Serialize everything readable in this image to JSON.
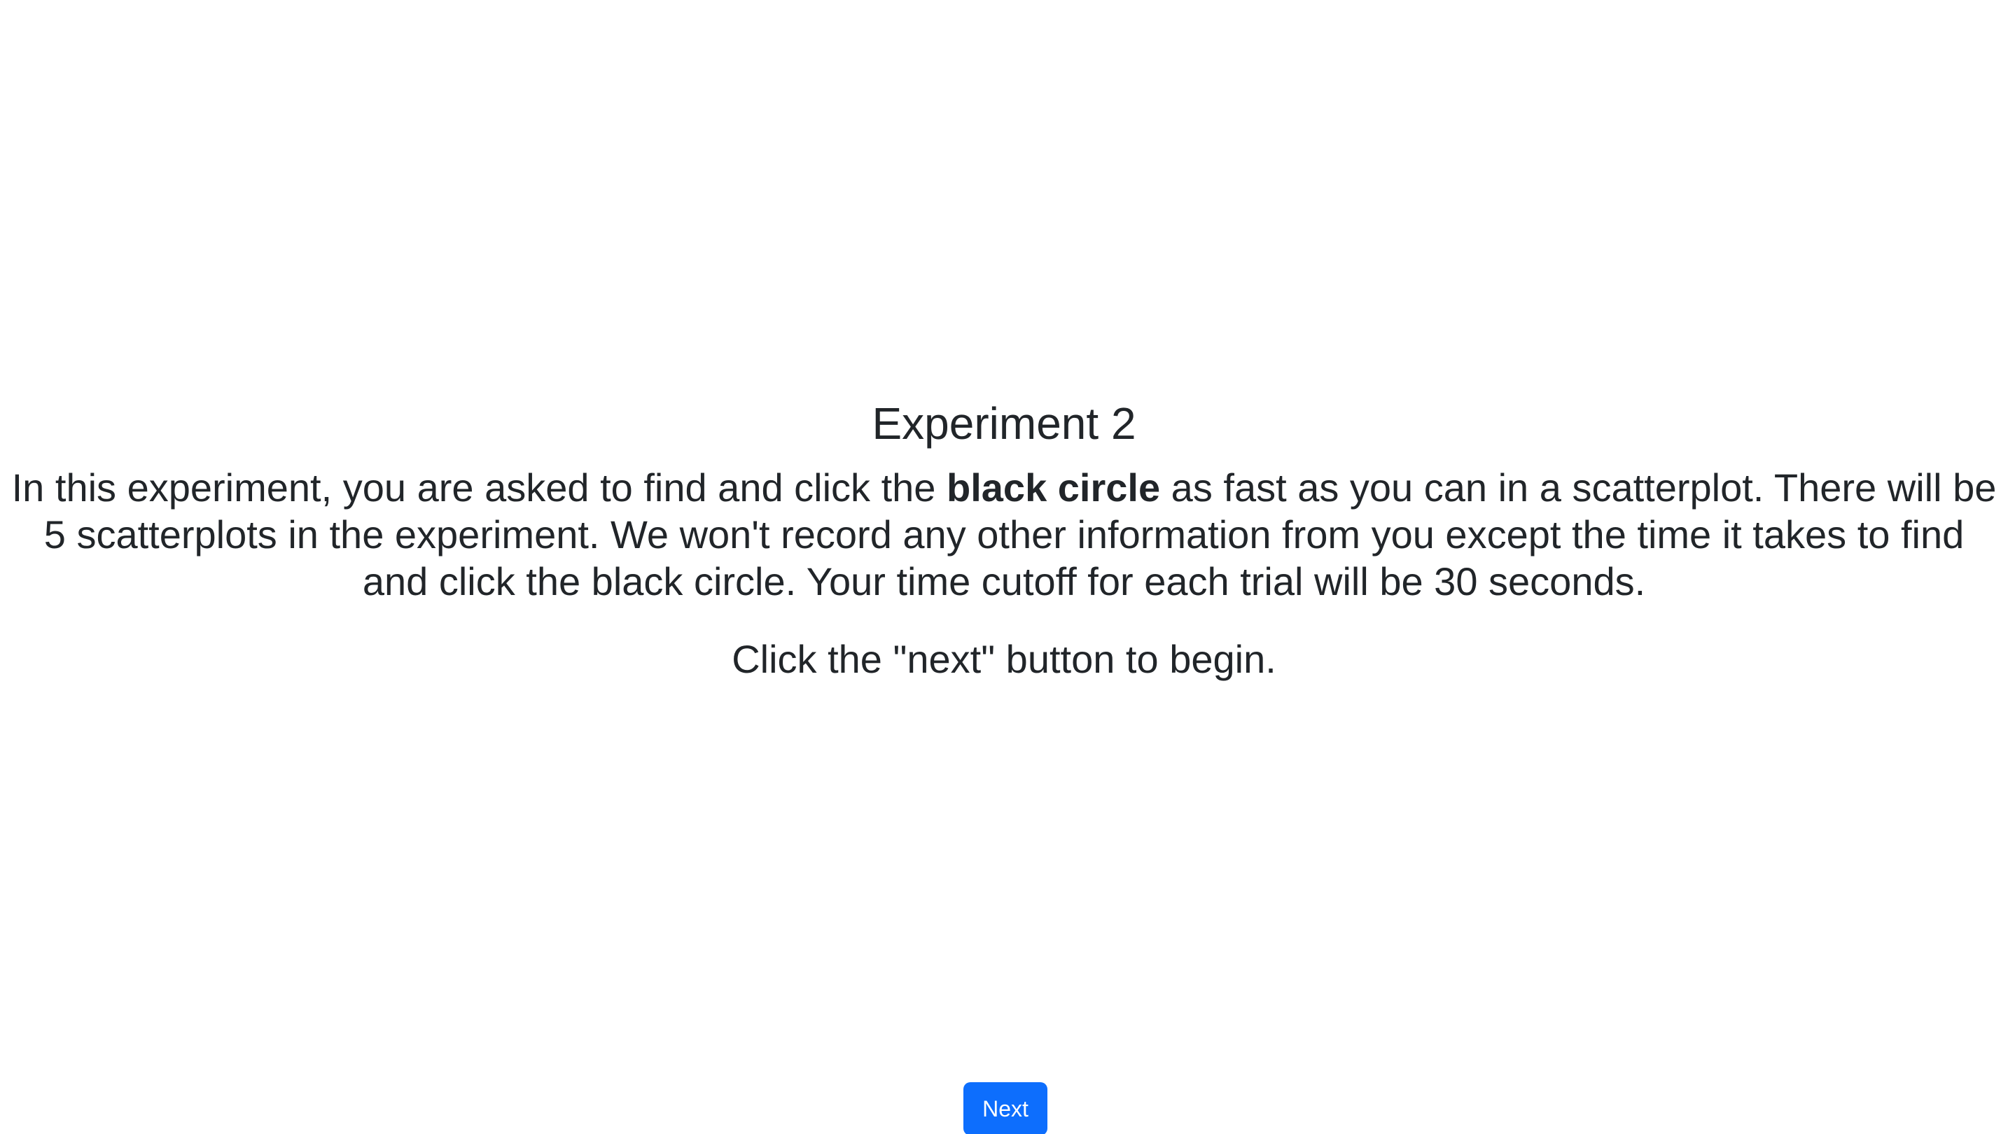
{
  "page": {
    "title": "Experiment 2",
    "instructions": {
      "part1": "In this experiment, you are asked to find and click the ",
      "emphasis": "black circle",
      "part2": " as fast as you can in a scatterplot. There will be 5 scatterplots in the experiment. We won't record any other information from you except the time it takes to find and click the black circle. Your time cutoff for each trial will be 30 seconds."
    },
    "prompt": "Click the \"next\" button to begin."
  },
  "actions": {
    "next_label": "Next"
  },
  "colors": {
    "text": "#212529",
    "primary_button": "#0d6efd",
    "background": "#ffffff"
  }
}
